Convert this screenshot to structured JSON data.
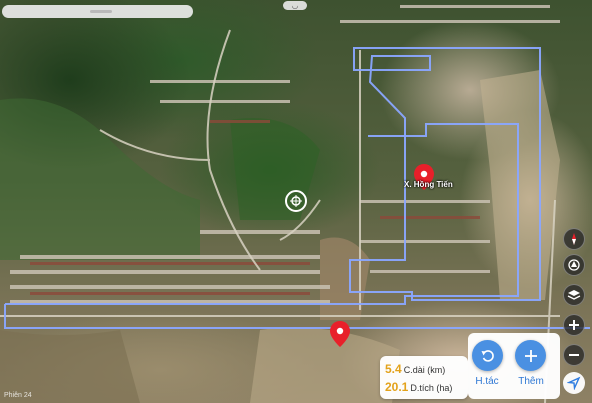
{
  "map": {
    "place_label": "X. Hồng Tiến",
    "watermark": "Phiên 24"
  },
  "top_handle": "◡",
  "measurement": {
    "length_value": "5.4",
    "length_label": "C.dài (km)",
    "area_value": "20.1",
    "area_label": "D.tích (ha)"
  },
  "actions": {
    "undo_label": "H.tác",
    "add_label": "Thêm"
  },
  "side_controls": [
    "compass-icon",
    "layers-rotate-icon",
    "layers-icon",
    "zoom-in-icon",
    "zoom-out-icon",
    "locate-icon"
  ],
  "colors": {
    "accent": "#4a90e2",
    "value": "#e3a21a",
    "boundary": "#8aa7ff",
    "pin": "#e8202a"
  }
}
